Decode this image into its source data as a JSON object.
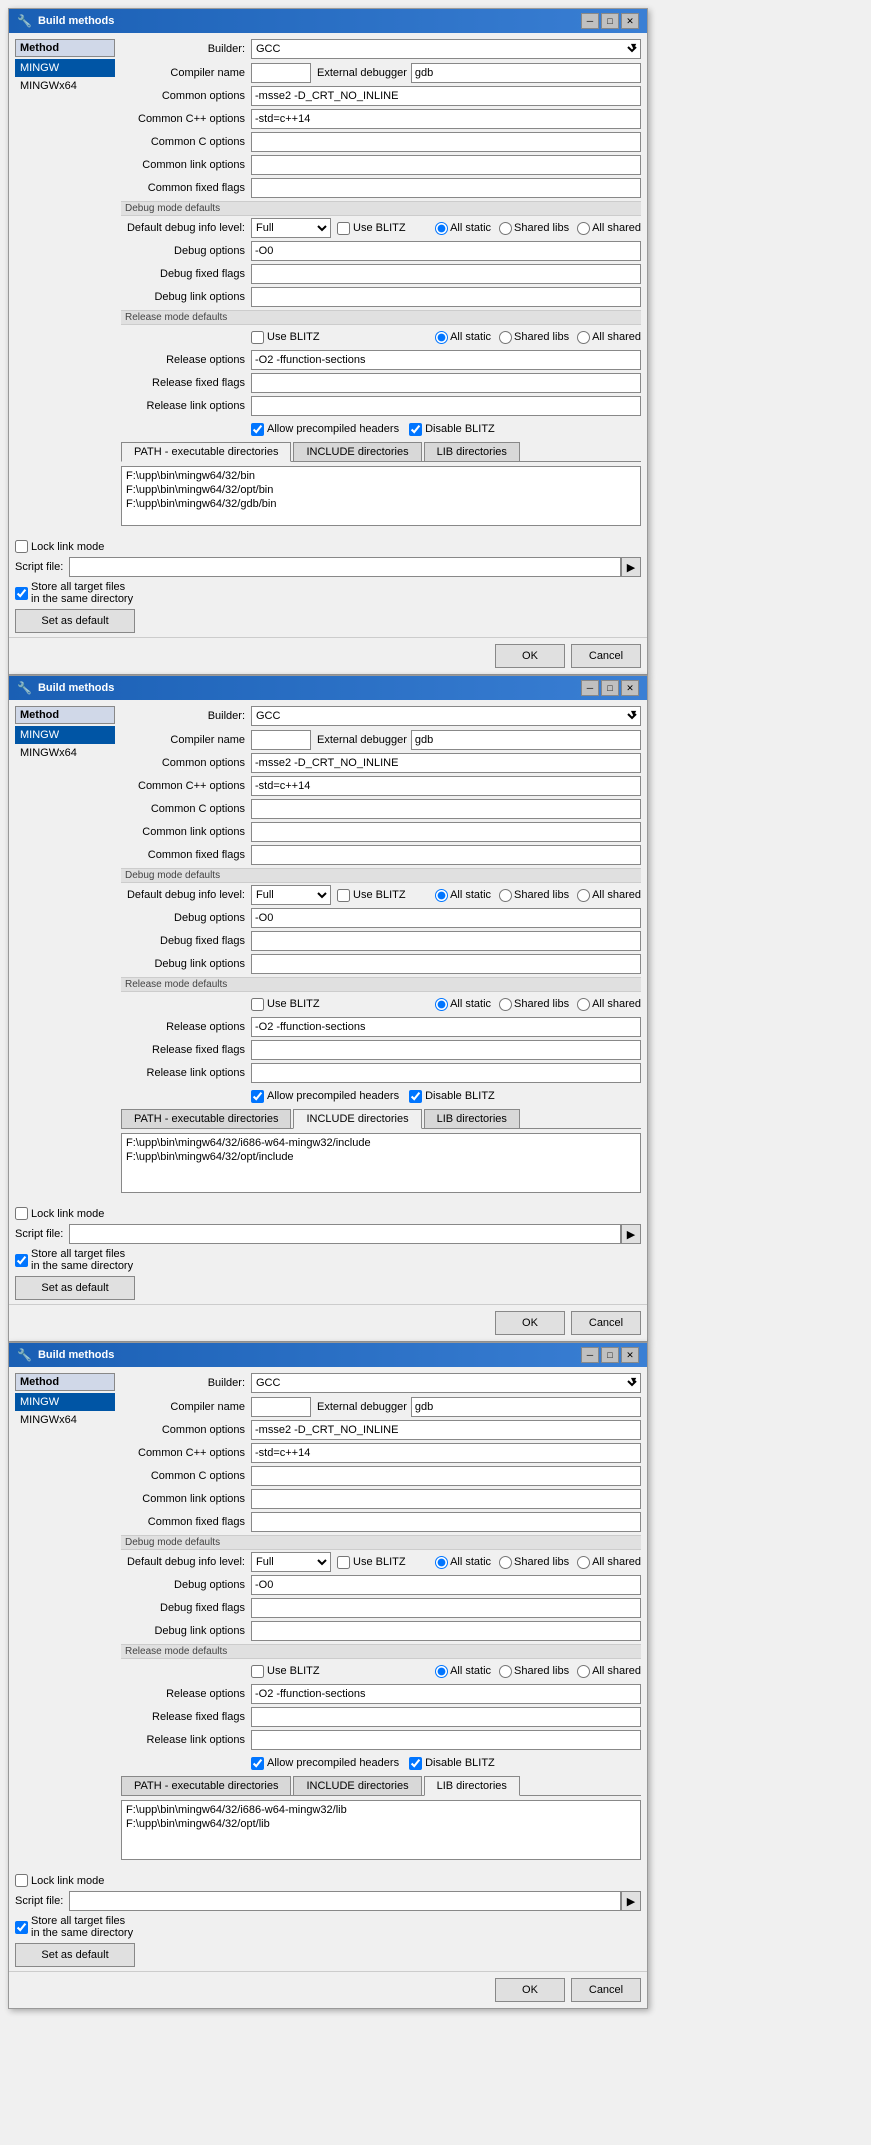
{
  "dialogs": [
    {
      "id": "dialog1",
      "title": "Build methods",
      "builder": "GCC",
      "methods": [
        "MINGW",
        "MINGWx64"
      ],
      "selected_method": "MINGW",
      "compiler_name": "",
      "external_debugger": "gdb",
      "common_options": "-msse2 -D_CRT_NO_INLINE",
      "common_cpp_options": "-std=c++14",
      "common_c_options": "",
      "common_link_options": "",
      "common_fixed_flags": "",
      "debug_mode_defaults_label": "Debug mode defaults",
      "default_debug_info_level_label": "Default debug info level:",
      "debug_info_level": "Full",
      "use_blitz_debug": false,
      "debug_static": true,
      "debug_shared_libs": false,
      "debug_all_shared": false,
      "debug_options": "-O0",
      "debug_fixed_flags": "",
      "debug_link_options": "",
      "release_mode_defaults_label": "Release mode defaults",
      "use_blitz_release": false,
      "release_static": true,
      "release_shared_libs": false,
      "release_all_shared": false,
      "release_options": "-O2 -ffunction-sections",
      "release_fixed_flags": "",
      "release_link_options": "",
      "allow_precompiled_headers": true,
      "disable_blitz": true,
      "tabs": [
        "PATH - executable directories",
        "INCLUDE directories",
        "LIB directories"
      ],
      "active_tab": "PATH - executable directories",
      "paths": [
        "F:\\upp\\bin\\mingw64/32/bin",
        "F:\\upp\\bin\\mingw64/32/opt/bin",
        "F:\\upp\\bin\\mingw64/32/gdb/bin"
      ],
      "lock_link_mode": false,
      "script_file_label": "Script file:",
      "script_file": "",
      "store_all_target_files": true,
      "store_label_line1": "Store all target files",
      "store_label_line2": "in the same directory",
      "set_default_label": "Set as default",
      "ok_label": "OK",
      "cancel_label": "Cancel"
    },
    {
      "id": "dialog2",
      "title": "Build methods",
      "builder": "GCC",
      "methods": [
        "MINGW",
        "MINGWx64"
      ],
      "selected_method": "MINGW",
      "compiler_name": "",
      "external_debugger": "gdb",
      "common_options": "-msse2 -D_CRT_NO_INLINE",
      "common_cpp_options": "-std=c++14",
      "common_c_options": "",
      "common_link_options": "",
      "common_fixed_flags": "",
      "debug_mode_defaults_label": "Debug mode defaults",
      "default_debug_info_level_label": "Default debug info level:",
      "debug_info_level": "Full",
      "use_blitz_debug": false,
      "debug_static": true,
      "debug_shared_libs": false,
      "debug_all_shared": false,
      "debug_options": "-O0",
      "debug_fixed_flags": "",
      "debug_link_options": "",
      "release_mode_defaults_label": "Release mode defaults",
      "use_blitz_release": false,
      "release_static": true,
      "release_shared_libs": false,
      "release_all_shared": false,
      "release_options": "-O2 -ffunction-sections",
      "release_fixed_flags": "",
      "release_link_options": "",
      "allow_precompiled_headers": true,
      "disable_blitz": true,
      "tabs": [
        "PATH - executable directories",
        "INCLUDE directories",
        "LIB directories"
      ],
      "active_tab": "INCLUDE directories",
      "paths": [
        "F:\\upp\\bin\\mingw64/32/i686-w64-mingw32/include",
        "F:\\upp\\bin\\mingw64/32/opt/include"
      ],
      "lock_link_mode": false,
      "script_file_label": "Script file:",
      "script_file": "",
      "store_all_target_files": true,
      "store_label_line1": "Store all target files",
      "store_label_line2": "in the same directory",
      "set_default_label": "Set as default",
      "ok_label": "OK",
      "cancel_label": "Cancel"
    },
    {
      "id": "dialog3",
      "title": "Build methods",
      "builder": "GCC",
      "methods": [
        "MINGW",
        "MINGWx64"
      ],
      "selected_method": "MINGW",
      "compiler_name": "",
      "external_debugger": "gdb",
      "common_options": "-msse2 -D_CRT_NO_INLINE",
      "common_cpp_options": "-std=c++14",
      "common_c_options": "",
      "common_link_options": "",
      "common_fixed_flags": "",
      "debug_mode_defaults_label": "Debug mode defaults",
      "default_debug_info_level_label": "Default debug info level:",
      "debug_info_level": "Full",
      "use_blitz_debug": false,
      "debug_static": true,
      "debug_shared_libs": false,
      "debug_all_shared": false,
      "debug_options": "-O0",
      "debug_fixed_flags": "",
      "debug_link_options": "",
      "release_mode_defaults_label": "Release mode defaults",
      "use_blitz_release": false,
      "release_static": true,
      "release_shared_libs": false,
      "release_all_shared": false,
      "release_options": "-O2 -ffunction-sections",
      "release_fixed_flags": "",
      "release_link_options": "",
      "allow_precompiled_headers": true,
      "disable_blitz": true,
      "tabs": [
        "PATH - executable directories",
        "INCLUDE directories",
        "LIB directories"
      ],
      "active_tab": "LIB directories",
      "paths": [
        "F:\\upp\\bin\\mingw64/32/i686-w64-mingw32/lib",
        "F:\\upp\\bin\\mingw64/32/opt/lib"
      ],
      "lock_link_mode": false,
      "script_file_label": "Script file:",
      "script_file": "",
      "store_all_target_files": true,
      "store_label_line1": "Store all target files",
      "store_label_line2": "in the same directory",
      "set_default_label": "Set as default",
      "ok_label": "OK",
      "cancel_label": "Cancel"
    }
  ],
  "labels": {
    "method_col": "Method",
    "builder_label": "Builder:",
    "compiler_name_label": "Compiler name",
    "external_debugger_label": "External debugger",
    "common_options_label": "Common options",
    "common_cpp_label": "Common C++ options",
    "common_c_label": "Common C options",
    "common_link_label": "Common link options",
    "common_fixed_label": "Common fixed flags",
    "debug_mode_defaults": "Debug mode defaults",
    "default_debug_info": "Default debug info level:",
    "debug_options_label": "Debug options",
    "debug_fixed_label": "Debug fixed flags",
    "debug_link_label": "Debug link options",
    "release_mode_defaults": "Release mode defaults",
    "use_blitz_label": "Use BLITZ",
    "release_options_label": "Release options",
    "release_fixed_label": "Release fixed flags",
    "release_link_label": "Release link options",
    "allow_precompiled": "Allow precompiled headers",
    "disable_blitz": "Disable BLITZ",
    "all_static": "All static",
    "shared_libs": "Shared libs",
    "all_shared": "All shared",
    "lock_link_mode": "Lock link mode",
    "script_file": "Script file:",
    "store_line1": "Store all target files",
    "store_line2": "in the same directory",
    "set_default": "Set as default",
    "ok": "OK",
    "cancel": "Cancel",
    "full": "Full"
  }
}
